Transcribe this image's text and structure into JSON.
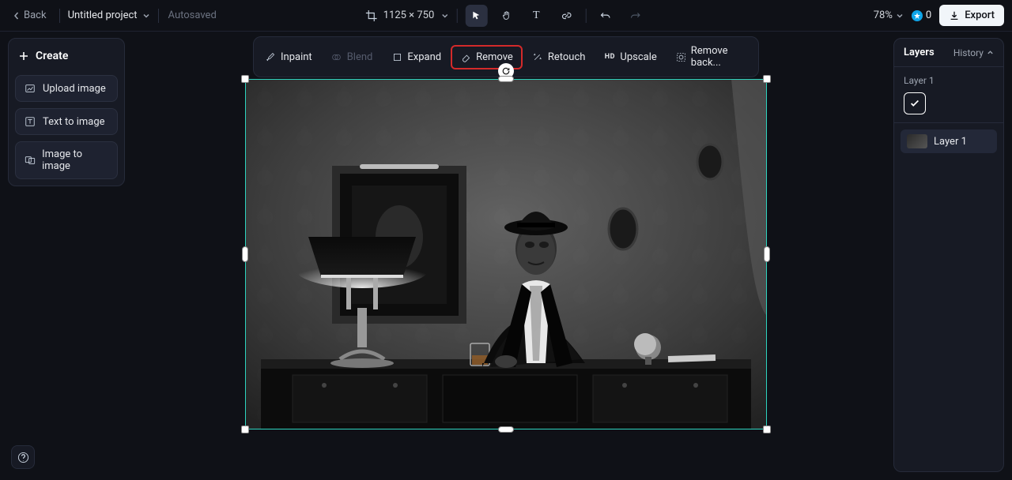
{
  "header": {
    "back": "Back",
    "project_title": "Untitled project",
    "autosaved": "Autosaved",
    "dimensions": "1125 × 750",
    "zoom": "78%",
    "credits": "0",
    "export": "Export"
  },
  "left_panel": {
    "create": "Create",
    "upload": "Upload image",
    "text_to_image": "Text to image",
    "image_to_image": "Image to image"
  },
  "toolbar": {
    "inpaint": "Inpaint",
    "blend": "Blend",
    "expand": "Expand",
    "remove": "Remove",
    "retouch": "Retouch",
    "upscale": "Upscale",
    "remove_bg": "Remove back..."
  },
  "right_panel": {
    "layers": "Layers",
    "history": "History",
    "layer1": "Layer 1"
  }
}
